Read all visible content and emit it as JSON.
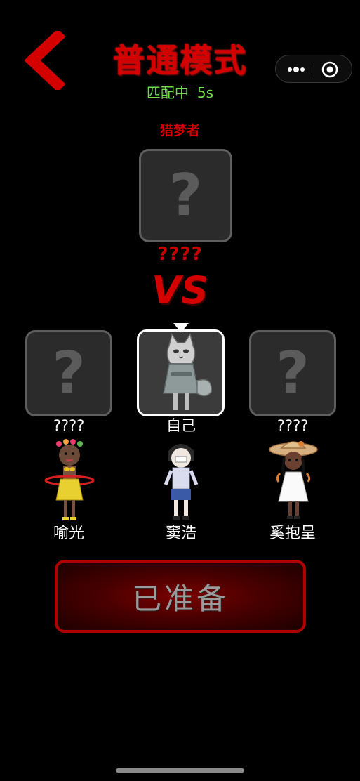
{
  "header": {
    "title": "普通模式",
    "status_text": "匹配中",
    "timer": "5s",
    "back_icon": "chevron-left-icon",
    "capsule": {
      "more_icon": "more-dots-icon",
      "close_icon": "target-close-icon"
    }
  },
  "hunter": {
    "role_label": "猎梦者",
    "card_symbol": "?",
    "name": "????"
  },
  "versus": {
    "label": "VS"
  },
  "players": [
    {
      "slot_label": "????",
      "card_symbol": "?",
      "name": "喻光",
      "selected": false
    },
    {
      "slot_label": "自己",
      "card_symbol": "",
      "name": "窦浩",
      "selected": true
    },
    {
      "slot_label": "????",
      "card_symbol": "?",
      "name": "奚抱呈",
      "selected": false
    }
  ],
  "ready_button": {
    "label": "已准备"
  },
  "colors": {
    "accent_red": "#d40000",
    "status_green": "#6fe04a",
    "card_bg": "#2b2b2b",
    "card_border": "#5e5e5e",
    "selected_border": "#ffffff"
  }
}
